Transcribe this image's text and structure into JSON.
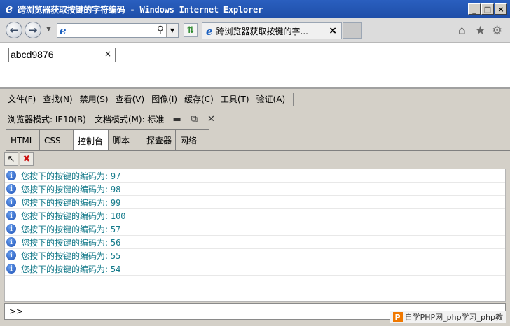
{
  "window": {
    "title": "跨浏览器获取按键的字符编码 - Windows Internet Explorer",
    "controls": [
      "_",
      "□",
      "×"
    ]
  },
  "nav": {
    "address_value": "",
    "tab_title": "跨浏览器获取按键的字...",
    "icons": [
      "back-icon",
      "forward-icon",
      "refresh-icon",
      "home-icon",
      "star-icon",
      "gear-icon"
    ]
  },
  "page": {
    "input_value": "abcd9876",
    "clear_glyph": "×"
  },
  "devtools": {
    "menu": [
      "文件(F)",
      "查找(N)",
      "禁用(S)",
      "查看(V)",
      "图像(I)",
      "缓存(C)",
      "工具(T)",
      "验证(A)"
    ],
    "browser_mode": "浏览器模式: IE10(B)",
    "doc_mode": "文档模式(M): 标准",
    "tabs": [
      "HTML",
      "CSS",
      "控制台",
      "脚本",
      "探查器",
      "网络"
    ],
    "active_tab": "控制台",
    "console": {
      "prefix": "您按下的按键的编码为: ",
      "codes": [
        "97",
        "98",
        "99",
        "100",
        "57",
        "56",
        "55",
        "54"
      ]
    },
    "prompt": ">>"
  },
  "watermark": {
    "logo": "P",
    "text": "自学PHP网_php学习_php教"
  }
}
